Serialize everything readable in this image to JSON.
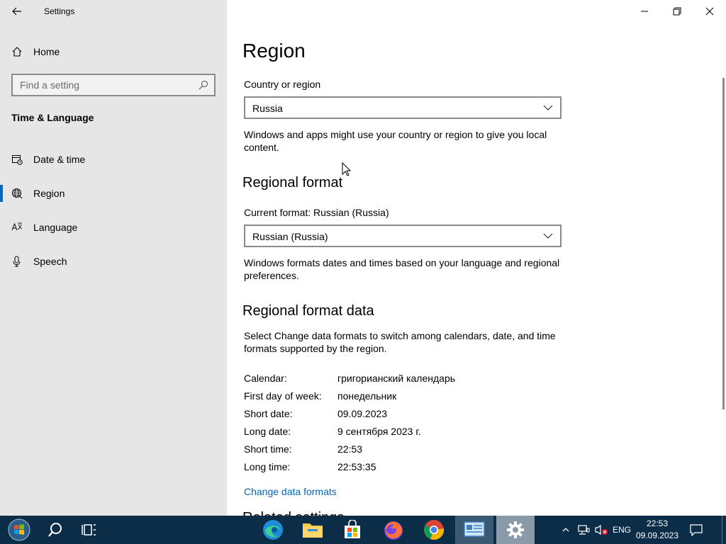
{
  "window": {
    "title": "Settings",
    "minimize_glyph": "—",
    "restore_glyph": "❐",
    "close_glyph": "✕"
  },
  "sidebar": {
    "home_label": "Home",
    "search_placeholder": "Find a setting",
    "section_title": "Time & Language",
    "items": [
      {
        "label": "Date & time",
        "icon": "calendar-clock-icon"
      },
      {
        "label": "Region",
        "icon": "globe-icon",
        "selected": true
      },
      {
        "label": "Language",
        "icon": "language-icon"
      },
      {
        "label": "Speech",
        "icon": "microphone-icon"
      }
    ]
  },
  "main": {
    "title": "Region",
    "country_label": "Country or region",
    "country_value": "Russia",
    "country_desc": "Windows and apps might use your country or region to give you local content.",
    "regional_format_head": "Regional format",
    "current_format_label": "Current format: Russian (Russia)",
    "format_value": "Russian (Russia)",
    "format_desc": "Windows formats dates and times based on your language and regional preferences.",
    "format_data_head": "Regional format data",
    "format_data_desc": "Select Change data formats to switch among calendars, date, and time formats supported by the region.",
    "format_data": [
      {
        "key": "Calendar:",
        "value": "григорианский календарь"
      },
      {
        "key": "First day of week:",
        "value": "понедельник"
      },
      {
        "key": "Short date:",
        "value": "09.09.2023"
      },
      {
        "key": "Long date:",
        "value": "9 сентября 2023 г."
      },
      {
        "key": "Short time:",
        "value": "22:53"
      },
      {
        "key": "Long time:",
        "value": "22:53:35"
      }
    ],
    "change_link": "Change data formats",
    "related_head": "Related settings"
  },
  "taskbar": {
    "lang": "ENG",
    "time": "22:53",
    "date": "09.09.2023"
  },
  "colors": {
    "accent": "#0067c0",
    "sidebar_bg": "#e6e6e6",
    "taskbar_bg": "#0c2d48"
  }
}
